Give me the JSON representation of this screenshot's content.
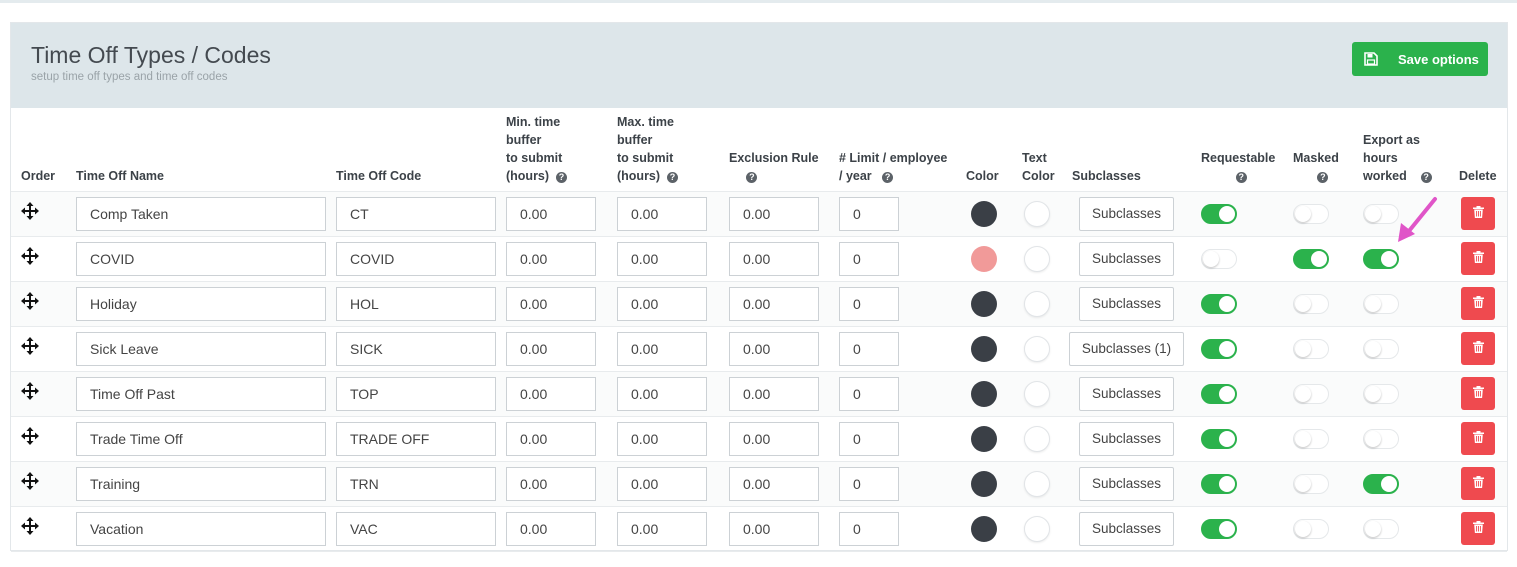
{
  "header": {
    "title": "Time Off Types / Codes",
    "subtitle": "setup time off types and time off codes",
    "save_label": "Save options",
    "save_icon": "floppy-disk-icon"
  },
  "colors": {
    "accent_green": "#2bb24c",
    "danger_red": "#ef4a4f",
    "header_bg": "#dde6ea",
    "annotation_arrow": "#e055c8"
  },
  "columns": {
    "order": "Order",
    "name": "Time Off Name",
    "code": "Time Off Code",
    "min_buffer": [
      "Min. time",
      "buffer",
      "to submit",
      "(hours)"
    ],
    "max_buffer": [
      "Max. time",
      "buffer",
      "to submit",
      "(hours)"
    ],
    "exclusion": "Exclusion Rule",
    "limit": [
      "# Limit / employee",
      "/ year"
    ],
    "color": "Color",
    "text_color": [
      "Text",
      "Color"
    ],
    "subclasses": "Subclasses",
    "requestable": "Requestable",
    "masked": "Masked",
    "export": [
      "Export as",
      "hours",
      "worked"
    ],
    "delete": "Delete",
    "help_glyph": "?"
  },
  "rows": [
    {
      "name": "Comp Taken",
      "code": "CT",
      "min": "0.00",
      "max": "0.00",
      "exclusion": "0.00",
      "limit": "0",
      "color": "#3a3f46",
      "text_color": "#ffffff",
      "subclasses": "Subclasses",
      "requestable": true,
      "masked": false,
      "export": false
    },
    {
      "name": "COVID",
      "code": "COVID",
      "min": "0.00",
      "max": "0.00",
      "exclusion": "0.00",
      "limit": "0",
      "color": "#f19a99",
      "text_color": "#ffffff",
      "subclasses": "Subclasses",
      "requestable": false,
      "masked": true,
      "export": true
    },
    {
      "name": "Holiday",
      "code": "HOL",
      "min": "0.00",
      "max": "0.00",
      "exclusion": "0.00",
      "limit": "0",
      "color": "#3a3f46",
      "text_color": "#ffffff",
      "subclasses": "Subclasses",
      "requestable": true,
      "masked": false,
      "export": false
    },
    {
      "name": "Sick Leave",
      "code": "SICK",
      "min": "0.00",
      "max": "0.00",
      "exclusion": "0.00",
      "limit": "0",
      "color": "#3a3f46",
      "text_color": "#ffffff",
      "subclasses": "Subclasses (1)",
      "requestable": true,
      "masked": false,
      "export": false
    },
    {
      "name": "Time Off Past",
      "code": "TOP",
      "min": "0.00",
      "max": "0.00",
      "exclusion": "0.00",
      "limit": "0",
      "color": "#3a3f46",
      "text_color": "#ffffff",
      "subclasses": "Subclasses",
      "requestable": true,
      "masked": false,
      "export": false
    },
    {
      "name": "Trade Time Off",
      "code": "TRADE OFF",
      "min": "0.00",
      "max": "0.00",
      "exclusion": "0.00",
      "limit": "0",
      "color": "#3a3f46",
      "text_color": "#ffffff",
      "subclasses": "Subclasses",
      "requestable": true,
      "masked": false,
      "export": false
    },
    {
      "name": "Training",
      "code": "TRN",
      "min": "0.00",
      "max": "0.00",
      "exclusion": "0.00",
      "limit": "0",
      "color": "#3a3f46",
      "text_color": "#ffffff",
      "subclasses": "Subclasses",
      "requestable": true,
      "masked": false,
      "export": true
    },
    {
      "name": "Vacation",
      "code": "VAC",
      "min": "0.00",
      "max": "0.00",
      "exclusion": "0.00",
      "limit": "0",
      "color": "#3a3f46",
      "text_color": "#ffffff",
      "subclasses": "Subclasses",
      "requestable": true,
      "masked": false,
      "export": false
    }
  ]
}
